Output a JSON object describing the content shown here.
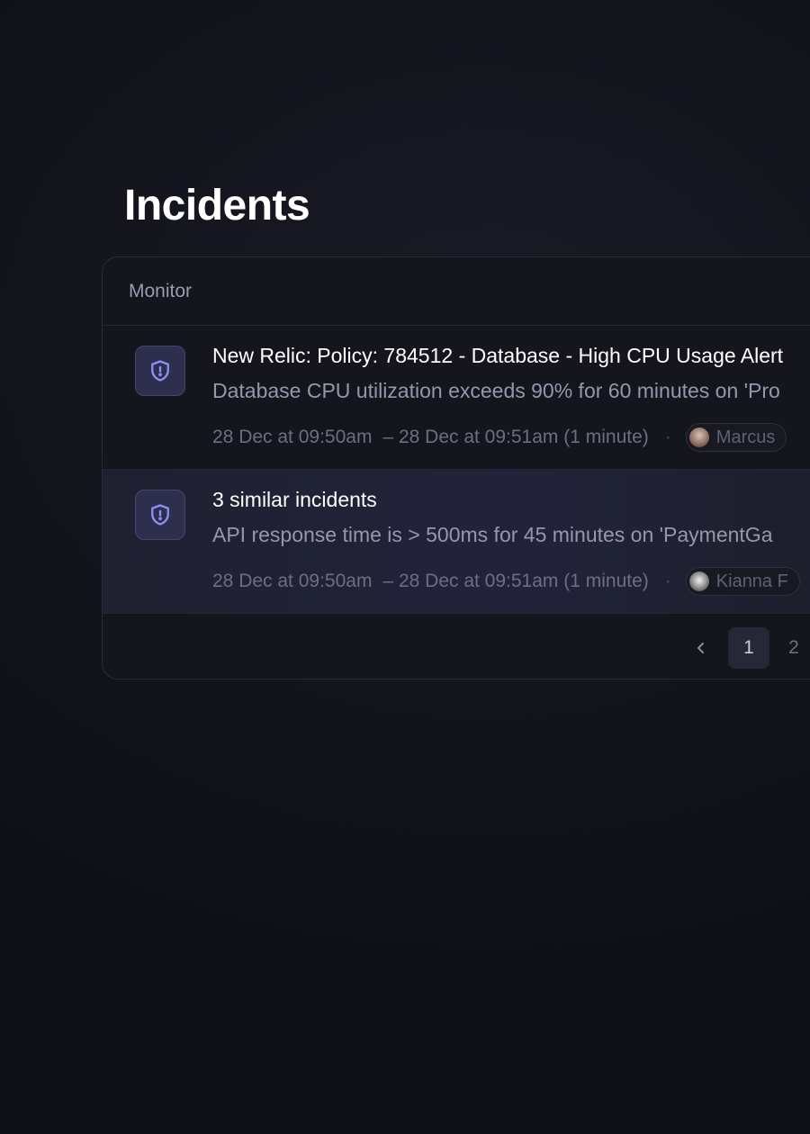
{
  "page": {
    "title": "Incidents"
  },
  "table": {
    "column_header": "Monitor"
  },
  "incidents": [
    {
      "title": "New Relic: Policy: 784512 - Database - High CPU Usage Alert",
      "description": "Database CPU utilization exceeds 90% for 60 minutes on 'Pro",
      "start": "28 Dec at 09:50am",
      "end": "– 28 Dec at 09:51am (1 minute)",
      "separator": "·",
      "user": "Marcus",
      "icon": "shield-alert-icon"
    },
    {
      "title": "3 similar incidents",
      "description": "API response time is > 500ms for 45 minutes on 'PaymentGa",
      "start": "28 Dec at 09:50am",
      "end": "– 28 Dec at 09:51am (1 minute)",
      "separator": "·",
      "user": "Kianna F",
      "icon": "shield-alert-icon"
    }
  ],
  "pagination": {
    "pages": [
      "1",
      "2"
    ],
    "current": "1"
  },
  "colors": {
    "accent": "#8b8ff7",
    "icon_bg": "#2d2f4d",
    "background": "#13141c"
  }
}
